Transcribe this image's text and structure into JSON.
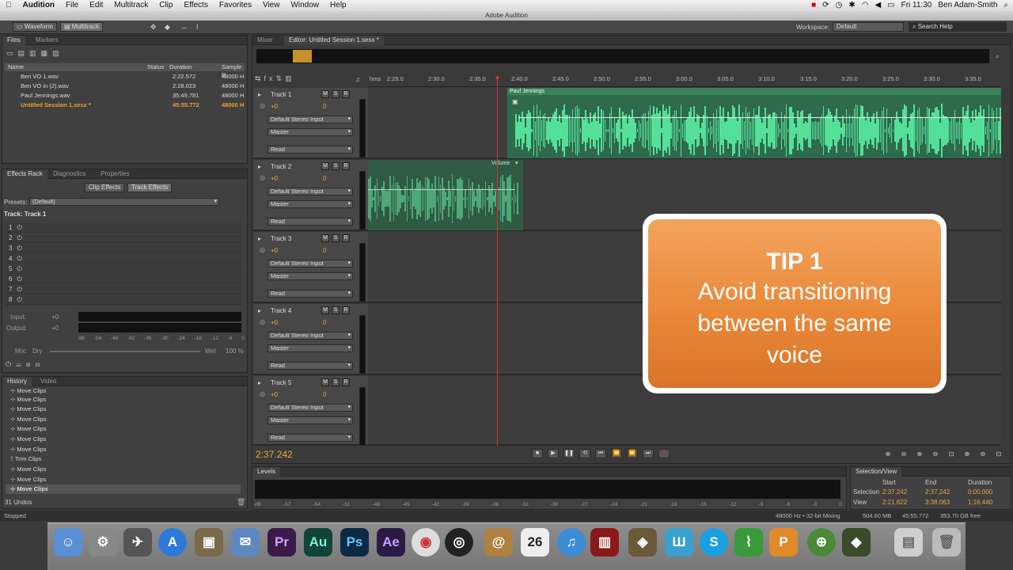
{
  "menubar": {
    "app": "Audition",
    "items": [
      "File",
      "Edit",
      "Multitrack",
      "Clip",
      "Effects",
      "Favorites",
      "View",
      "Window",
      "Help"
    ],
    "clock": "Fri 11:30",
    "user": "Ben Adam-Smith"
  },
  "window_title": "Adobe Audition",
  "toolbar": {
    "waveform": "Waveform",
    "multitrack": "Multitrack",
    "workspace_label": "Workspace:",
    "workspace_value": "Default",
    "search_placeholder": "Search Help"
  },
  "files": {
    "tabs": [
      "Files",
      "Markers"
    ],
    "headers": {
      "name": "Name",
      "status": "Status",
      "duration": "Duration",
      "rate": "Sample R"
    },
    "rows": [
      {
        "name": "Ben VO 1.wav",
        "duration": "2:22.572",
        "rate": "48000 H"
      },
      {
        "name": "Ben VO in (2).wav",
        "duration": "2:28.023",
        "rate": "48000 H"
      },
      {
        "name": "Paul Jennings.wav",
        "duration": "35:49.781",
        "rate": "48000 H"
      },
      {
        "name": "Untitled Session 1.sesx *",
        "duration": "45:55.772",
        "rate": "48000 H"
      }
    ]
  },
  "effects": {
    "tabs": [
      "Effects Rack",
      "Diagnostics",
      "Properties"
    ],
    "clip_effects": "Clip Effects",
    "track_effects": "Track Effects",
    "presets_label": "Presets:",
    "presets_value": "(Default)",
    "track_label": "Track: Track 1",
    "slots": [
      "1",
      "2",
      "3",
      "4",
      "5",
      "6",
      "7",
      "8"
    ],
    "input": "Input:",
    "output": "Output:",
    "vol": "+0",
    "mix": "Mix:",
    "dry": "Dry",
    "wet": "Wet",
    "wet_pct": "100 %",
    "meter_scale": [
      "dB",
      "-54",
      "-48",
      "-42",
      "-36",
      "-30",
      "-24",
      "-18",
      "-12",
      "-6",
      "0"
    ]
  },
  "history": {
    "tabs": [
      "History",
      "Video"
    ],
    "items": [
      "Move Clips",
      "Move Clips",
      "Move Clips",
      "Move Clips",
      "Move Clips",
      "Move Clips",
      "Move Clips",
      "Trim Clips",
      "Move Clips",
      "Move Clips",
      "Move Clips"
    ],
    "undos": "31 Undos"
  },
  "editor": {
    "tabs": [
      "Mixer",
      "Editor: Untitled Session 1.sesx *"
    ],
    "ruler": [
      "hms",
      "2:25.0",
      "2:30.0",
      "2:35.0",
      "2:40.0",
      "2:45.0",
      "2:50.0",
      "2:55.0",
      "3:00.0",
      "3:05.0",
      "3:10.0",
      "3:15.0",
      "3:20.0",
      "3:25.0",
      "3:30.0",
      "3:35.0"
    ],
    "tracks": [
      {
        "name": "Track 1",
        "vol": "+0",
        "pan": "0",
        "input": "Default Stereo Input",
        "output": "Master",
        "auto": "Read"
      },
      {
        "name": "Track 2",
        "vol": "+0",
        "pan": "0",
        "input": "Default Stereo Input",
        "output": "Master",
        "auto": "Read"
      },
      {
        "name": "Track 3",
        "vol": "+0",
        "pan": "0",
        "input": "Default Stereo Input",
        "output": "Master",
        "auto": "Read"
      },
      {
        "name": "Track 4",
        "vol": "+0",
        "pan": "0",
        "input": "Default Stereo Input",
        "output": "Master",
        "auto": "Read"
      },
      {
        "name": "Track 5",
        "vol": "+0",
        "pan": "0",
        "input": "Default Stereo Input",
        "output": "Master",
        "auto": "Read"
      }
    ],
    "clip1": "Paul Jennings",
    "clip2": "Volume",
    "timecode": "2:37.242"
  },
  "tip": {
    "title": "TIP 1",
    "body": "Avoid transitioning between the same voice"
  },
  "levels": {
    "title": "Levels",
    "scale": [
      "dB",
      "-57",
      "-54",
      "-51",
      "-48",
      "-45",
      "-42",
      "-39",
      "-36",
      "-33",
      "-30",
      "-27",
      "-24",
      "-21",
      "-18",
      "-15",
      "-12",
      "-9",
      "-6",
      "-3",
      "0"
    ]
  },
  "selection": {
    "title": "Selection/View",
    "start": "Start",
    "end": "End",
    "duration": "Duration",
    "sel_label": "Selection",
    "sel_start": "2:37.242",
    "sel_end": "2:37.242",
    "sel_dur": "0:00.000",
    "view_label": "View",
    "view_start": "2:21.622",
    "view_end": "3:38.063",
    "view_dur": "1:16.440"
  },
  "status": {
    "left": "Stopped",
    "info": "48000 Hz • 32-bit Mixing",
    "mem": "504.60 MB",
    "dur": "45:55.772",
    "free": "353.70 GB free"
  },
  "dock": {
    "date": "26",
    "date_month": "JUL"
  }
}
